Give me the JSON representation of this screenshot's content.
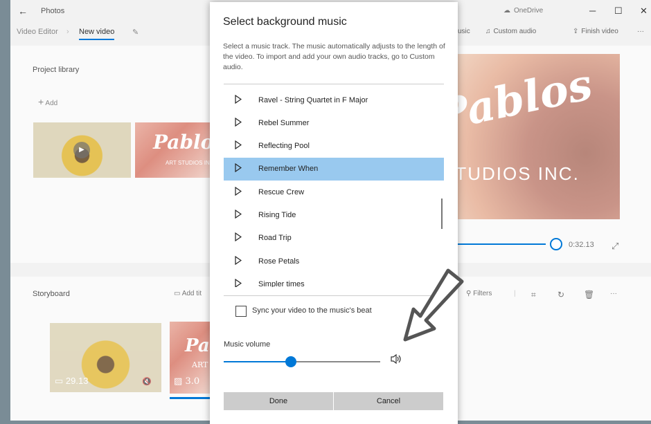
{
  "window": {
    "app_title": "Photos",
    "onedrive_label": "OneDrive",
    "controls": {
      "minimize": "─",
      "maximize": "☐",
      "close": "✕"
    }
  },
  "nav": {
    "breadcrumb_root": "Video Editor",
    "breadcrumb_current": "New video",
    "tools": {
      "music_partial": "usic",
      "custom_audio": "Custom audio",
      "finish_video": "Finish video",
      "more": "···"
    }
  },
  "library": {
    "title": "Project library",
    "add_label": "Add",
    "thumb2_script": "Pablos",
    "thumb2_studio": "ART STUDIOS IN"
  },
  "preview": {
    "script_text": "Pablos",
    "studio_text": "STUDIOS INC.",
    "time": "0:32.13",
    "progress": 1.0
  },
  "storyboard": {
    "title": "Storyboard",
    "add_title_partial": "Add tit",
    "filters_label": "Filters",
    "more": "···",
    "clips": [
      {
        "duration": "29.13",
        "script": ""
      },
      {
        "duration": "3.0",
        "script": "Pablos",
        "subtext": "ART"
      }
    ]
  },
  "dialog": {
    "title": "Select background music",
    "description": "Select a music track. The music automatically adjusts to the length of the video. To import and add your own audio tracks, go to Custom audio.",
    "tracks": [
      {
        "name": "Ravel - String Quartet in F Major",
        "selected": false
      },
      {
        "name": "Rebel Summer",
        "selected": false
      },
      {
        "name": "Reflecting Pool",
        "selected": false
      },
      {
        "name": "Remember When",
        "selected": true
      },
      {
        "name": "Rescue Crew",
        "selected": false
      },
      {
        "name": "Rising Tide",
        "selected": false
      },
      {
        "name": "Road Trip",
        "selected": false
      },
      {
        "name": "Rose Petals",
        "selected": false
      },
      {
        "name": "Simpler times",
        "selected": false
      }
    ],
    "sync_label": "Sync your video to the music's beat",
    "sync_checked": false,
    "volume_label": "Music volume",
    "volume_level": 0.43,
    "done_label": "Done",
    "cancel_label": "Cancel"
  },
  "colors": {
    "accent": "#0078d7",
    "selection": "#99c9ef",
    "button": "#cccccc"
  }
}
